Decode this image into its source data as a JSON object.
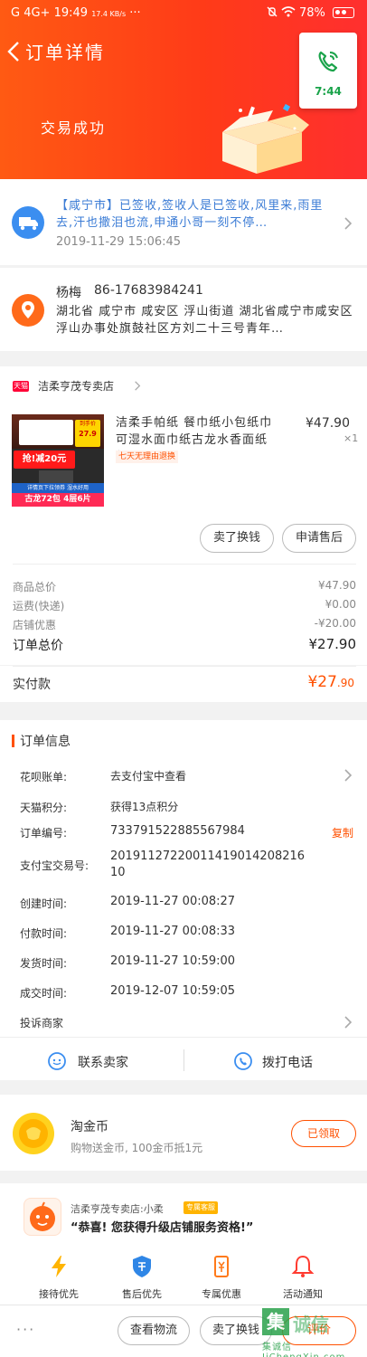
{
  "statusbar": {
    "left": "G 4G+ 19:49",
    "net_speed": "17.4 KB/s",
    "dots": "···",
    "battery": "78%"
  },
  "header": {
    "title": "订单详情",
    "status": "交易成功"
  },
  "call_widget": {
    "time": "7:44"
  },
  "logistics": {
    "text": "【咸宁市】已签收,签收人是已签收,风里来,雨里去,汗也撒泪也流,申通小哥一刻不停…",
    "time": "2019-11-29 15:06:45"
  },
  "address": {
    "name": "杨梅",
    "phone": "86-17683984241",
    "detail": "湖北省 咸宁市 咸安区 浮山街道 湖北省咸宁市咸安区浮山办事处旗鼓社区方刘二十三号青年…"
  },
  "store": {
    "badge": "天猫",
    "name": "洁柔亨茂专卖店"
  },
  "product": {
    "title": "洁柔手帕纸 餐巾纸小包纸巾 可湿水面巾纸古龙水香面纸超…",
    "price": "¥47.90",
    "qty": "×1",
    "tag": "七天无理由退换",
    "img_promo": "抢!减20元",
    "img_price_label": "到手价",
    "img_price": "27.9",
    "img_sub": "详情页下拉领券  湿水好用",
    "img_bottom": "古龙72包 4层6片"
  },
  "item_buttons": {
    "exchange": "卖了换钱",
    "aftersale": "申请售后"
  },
  "prices": [
    {
      "label": "商品总价",
      "value": "¥47.90"
    },
    {
      "label": "运费(快递)",
      "value": "¥0.00"
    },
    {
      "label": "店铺优惠",
      "value": "-¥20.00"
    }
  ],
  "order_total": {
    "label": "订单总价",
    "value": "¥27.90"
  },
  "paid": {
    "label": "实付款",
    "value_int": "¥27",
    "value_dec": ".90"
  },
  "order_info": {
    "title": "订单信息",
    "huabei_label": "花呗账单:",
    "huabei_value": "去支付宝中查看",
    "points_label": "天猫积分:",
    "points_value": "获得13点积分",
    "order_no_label": "订单编号:",
    "order_no": "733791522885567984",
    "copy": "复制",
    "alipay_label": "支付宝交易号:",
    "alipay_no_1": "2019112722001141901420821610",
    "alipay_no_2": "",
    "created_label": "创建时间:",
    "created": "2019-11-27 00:08:27",
    "paid_label": "付款时间:",
    "paid_time": "2019-11-27 00:08:33",
    "shipped_label": "发货时间:",
    "shipped": "2019-11-27 10:59:00",
    "done_label": "成交时间:",
    "done": "2019-12-07 10:59:05",
    "complain": "投诉商家"
  },
  "contact": {
    "seller": "联系卖家",
    "call": "拨打电话"
  },
  "coins": {
    "title": "淘金币",
    "desc": "购物送金币, 100金币抵1元",
    "btn": "已领取"
  },
  "service": {
    "name": "洁柔亨茂专卖店:小柔",
    "badge": "专属客服",
    "msg": "“恭喜! 您获得升级店铺服务资格!”",
    "items": [
      "接待优先",
      "售后优先",
      "专属优惠",
      "活动通知"
    ]
  },
  "bottom": {
    "more": "···",
    "logistics": "查看物流",
    "exchange": "卖了换钱",
    "review": "评价"
  },
  "watermark": "集诚信 JiChengXin.com",
  "colors": {
    "brand": "#ff5000",
    "link": "#3a7bd5",
    "green": "#1aa34a"
  }
}
